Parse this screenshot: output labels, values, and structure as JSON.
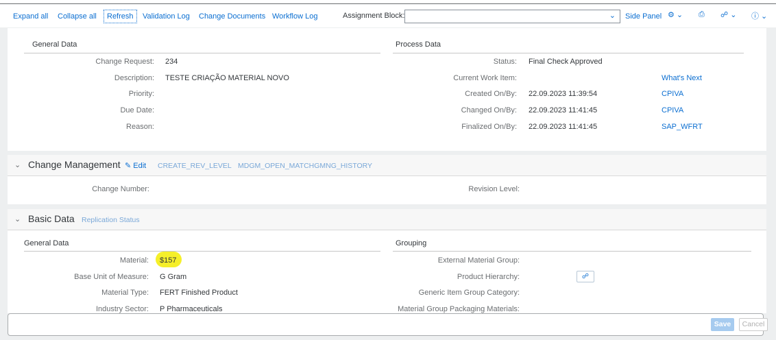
{
  "toolbar": {
    "expand_all": "Expand all",
    "collapse_all": "Collapse all",
    "refresh": "Refresh",
    "validation_log": "Validation Log",
    "change_documents": "Change Documents",
    "workflow_log": "Workflow Log",
    "assignment_block_label": "Assignment Block:",
    "assignment_block_value": "",
    "side_panel": "Side Panel",
    "settings_icon": "gear-icon",
    "print_icon": "print-icon",
    "hierarchy_icon": "hierarchy-icon",
    "help_icon": "help-icon"
  },
  "general_data": {
    "heading": "General Data",
    "fields": [
      {
        "label": "Change Request:",
        "value": "234"
      },
      {
        "label": "Description:",
        "value": "TESTE CRIAÇÃO MATERIAL NOVO"
      },
      {
        "label": "Priority:",
        "value": ""
      },
      {
        "label": "Due Date:",
        "value": ""
      },
      {
        "label": "Reason:",
        "value": ""
      }
    ]
  },
  "process_data": {
    "heading": "Process Data",
    "fields": [
      {
        "label": "Status:",
        "value": "Final Check Approved",
        "link": ""
      },
      {
        "label": "Current Work Item:",
        "value": "",
        "link": "What's Next"
      },
      {
        "label": "Created On/By:",
        "value": "22.09.2023 11:39:54",
        "link": "CPIVA"
      },
      {
        "label": "Changed On/By:",
        "value": "22.09.2023 11:41:45",
        "link": "CPIVA"
      },
      {
        "label": "Finalized On/By:",
        "value": "22.09.2023 11:41:45",
        "link": "SAP_WFRT"
      }
    ]
  },
  "change_management": {
    "title": "Change Management",
    "edit": "Edit",
    "link1": "CREATE_REV_LEVEL",
    "link2": "MDGM_OPEN_MATCHGMNG_HISTORY",
    "change_number_label": "Change Number:",
    "revision_level_label": "Revision Level:"
  },
  "basic_data": {
    "title": "Basic Data",
    "replication_status": "Replication Status",
    "general_heading": "General Data",
    "grouping_heading": "Grouping",
    "fields": [
      {
        "label": "Material:",
        "value": "$157"
      },
      {
        "label": "Base Unit of Measure:",
        "value": "G Gram"
      },
      {
        "label": "Material Type:",
        "value": "FERT Finished Product"
      },
      {
        "label": "Industry Sector:",
        "value": "P Pharmaceuticals"
      }
    ],
    "grouping_fields": [
      {
        "label": "External Material Group:"
      },
      {
        "label": "Product Hierarchy:"
      },
      {
        "label": "Generic Item Group Category:"
      },
      {
        "label": "Material Group Packaging Materials:"
      }
    ]
  },
  "footer": {
    "save": "Save",
    "cancel": "Cancel"
  },
  "colors": {
    "accent": "#0a6ed1",
    "highlight": "#f5ef2a",
    "save_disabled": "#a6cbef"
  }
}
